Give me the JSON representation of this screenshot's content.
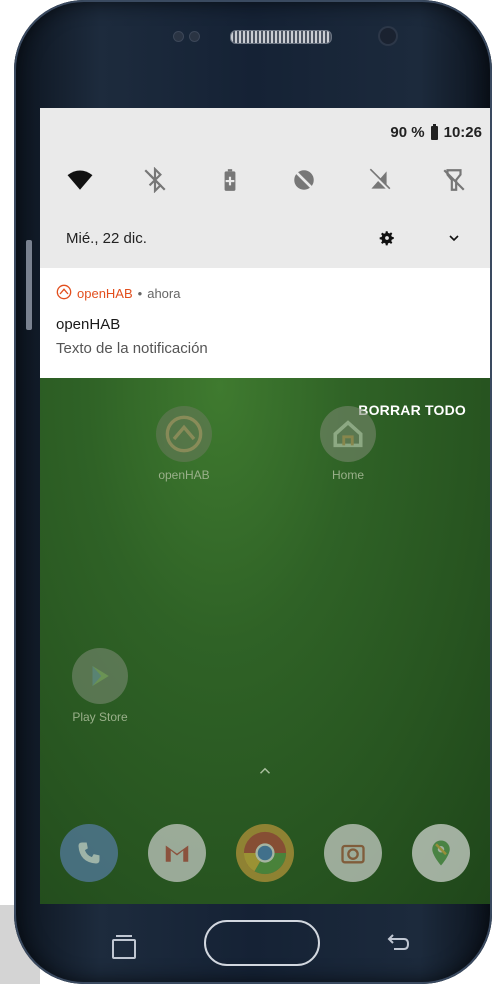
{
  "status_bar": {
    "battery": "90 %",
    "time": "10:26"
  },
  "quick_settings": {
    "tiles": [
      {
        "icon": "wifi-icon"
      },
      {
        "icon": "bluetooth-off-icon"
      },
      {
        "icon": "battery-saver-icon"
      },
      {
        "icon": "do-not-disturb-off-icon"
      },
      {
        "icon": "mobile-data-off-icon"
      },
      {
        "icon": "flashlight-off-icon"
      }
    ]
  },
  "shade": {
    "date": "Mié., 22 dic."
  },
  "notification": {
    "app_name": "openHAB",
    "separator": "•",
    "time": "ahora",
    "title": "openHAB",
    "text": "Texto de la notificación",
    "accent_color": "#e24f1e"
  },
  "actions": {
    "clear_all": "BORRAR TODO"
  },
  "home_screen": {
    "apps": [
      {
        "label": "openHAB",
        "icon": "openhab-icon"
      },
      {
        "label": "Home",
        "icon": "google-home-icon"
      },
      {
        "label": "Play Store",
        "icon": "play-store-icon"
      }
    ],
    "dock": [
      {
        "icon": "phone-icon"
      },
      {
        "icon": "gmail-icon"
      },
      {
        "icon": "chrome-icon"
      },
      {
        "icon": "camera-icon"
      },
      {
        "icon": "maps-icon"
      }
    ]
  }
}
